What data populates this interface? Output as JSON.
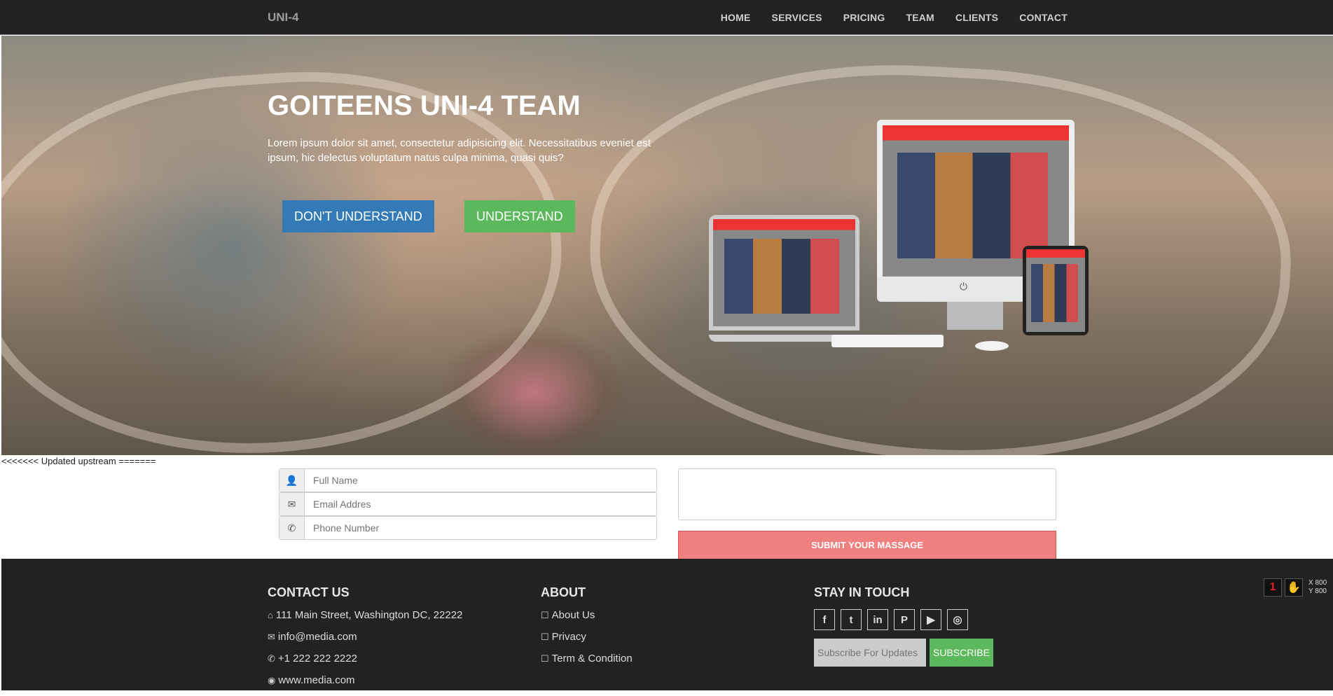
{
  "navbar": {
    "brand": "UNI-4",
    "links": [
      "HOME",
      "SERVICES",
      "PRICING",
      "TEAM",
      "CLIENTS",
      "CONTACT"
    ]
  },
  "hero": {
    "title": "GOITEENS UNI-4 TEAM",
    "text": "Lorem ipsum dolor sit amet, consectetur adipisicing elit. Necessitatibus eveniet est ipsum, hic delectus voluptatum natus culpa minima, quasi quis?",
    "btn_primary": "DON'T UNDERSTAND",
    "btn_secondary": "UNDERSTAND"
  },
  "conflict_marker": "<<<<<<< Updated upstream =======",
  "form": {
    "name_placeholder": "Full Name",
    "email_placeholder": "Email Addres",
    "phone_placeholder": "Phone Number",
    "submit_label": "SUBMIT YOUR MASSAGE"
  },
  "footer": {
    "contact": {
      "title": "CONTACT US",
      "address": "111 Main Street, Washington DC, 22222",
      "email": "info@media.com",
      "phone": "+1 222 222 2222",
      "website": "www.media.com"
    },
    "about": {
      "title": "ABOUT",
      "links": [
        "About Us",
        "Privacy",
        "Term & Condition"
      ]
    },
    "stay": {
      "title": "STAY IN TOUCH",
      "socials": [
        "facebook-icon",
        "twitter-icon",
        "linkedin-icon",
        "pinterest-icon",
        "youtube-icon",
        "github-icon"
      ],
      "subscribe_placeholder": "Subscribe For Updates",
      "subscribe_label": "SUBSCRIBE"
    }
  },
  "widget": {
    "x_label": "X 800",
    "y_label": "Y 800"
  },
  "colors": {
    "navbar": "#222222",
    "primary_button": "#337ab7",
    "success_button": "#5cb85c",
    "submit_button": "#f08080"
  }
}
